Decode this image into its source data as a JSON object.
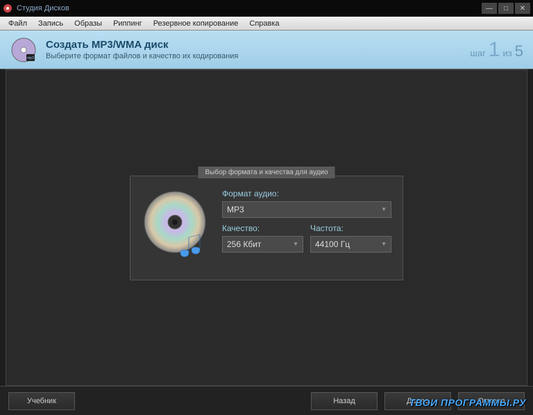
{
  "titlebar": {
    "title": "Студия Дисков"
  },
  "menu": {
    "file": "Файл",
    "record": "Запись",
    "images": "Образы",
    "ripping": "Риппинг",
    "backup": "Резервное копирование",
    "help": "Справка"
  },
  "banner": {
    "title": "Создать MP3/WMA диск",
    "subtitle": "Выберите формат файлов и качество их кодирования",
    "step_word": "шаг",
    "step_current": "1",
    "step_sep": "из",
    "step_total": "5"
  },
  "panel": {
    "header": "Выбор формата и качества для аудио",
    "format_label": "Формат аудио:",
    "format_value": "MP3",
    "quality_label": "Качество:",
    "quality_value": "256 Кбит",
    "freq_label": "Частота:",
    "freq_value": "44100 Гц"
  },
  "footer": {
    "tutorial": "Учебник",
    "back": "Назад",
    "next": "Далее",
    "cancel": "Отмена"
  },
  "watermark": "ТВОИ ПРОГРАММЫ.РУ"
}
